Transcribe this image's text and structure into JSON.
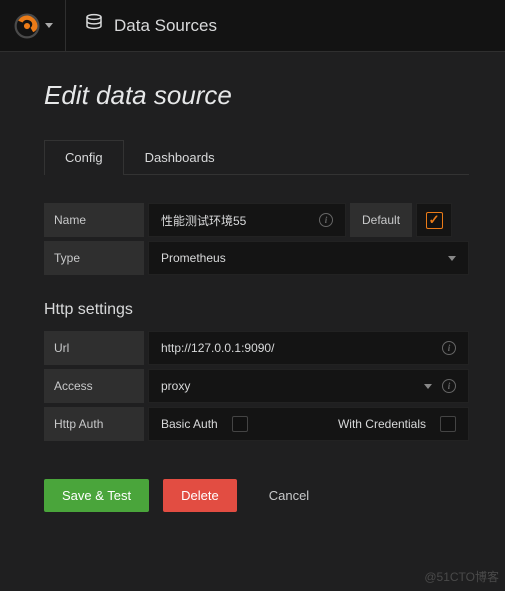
{
  "topbar": {
    "breadcrumb": "Data Sources"
  },
  "page": {
    "title": "Edit data source"
  },
  "tabs": {
    "config": "Config",
    "dashboards": "Dashboards"
  },
  "form": {
    "name_label": "Name",
    "name_value": "性能测试环境55",
    "default_label": "Default",
    "default_checked": true,
    "type_label": "Type",
    "type_value": "Prometheus"
  },
  "http": {
    "section_title": "Http settings",
    "url_label": "Url",
    "url_value": "http://127.0.0.1:9090/",
    "access_label": "Access",
    "access_value": "proxy",
    "auth_label": "Http Auth",
    "basic_auth_label": "Basic Auth",
    "with_credentials_label": "With Credentials"
  },
  "actions": {
    "save_test": "Save & Test",
    "delete": "Delete",
    "cancel": "Cancel"
  },
  "watermark": "@51CTO博客"
}
